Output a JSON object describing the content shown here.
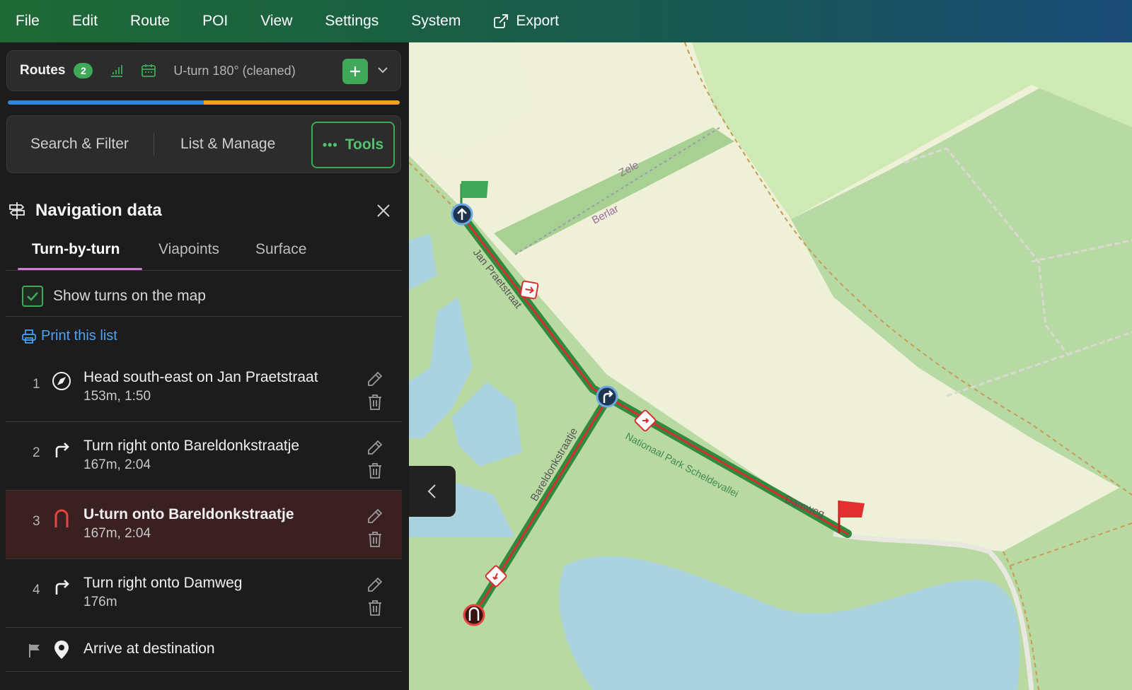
{
  "menu": {
    "items": [
      "File",
      "Edit",
      "Route",
      "POI",
      "View",
      "Settings",
      "System"
    ],
    "export_label": "Export"
  },
  "routes": {
    "label": "Routes",
    "count": "2",
    "current_route": "U-turn 180° (cleaned)"
  },
  "tool_tabs": {
    "search": "Search & Filter",
    "list": "List & Manage",
    "tools": "Tools"
  },
  "panel": {
    "title": "Navigation data",
    "tabs": [
      "Turn-by-turn",
      "Viapoints",
      "Surface"
    ],
    "show_turns_label": "Show turns on the map",
    "show_turns_checked": true,
    "print_label": "Print this list"
  },
  "turns": [
    {
      "num": "1",
      "icon": "compass-icon",
      "text": "Head south-east on Jan Praetstraat",
      "sub": "153m, 1:50"
    },
    {
      "num": "2",
      "icon": "turn-right-icon",
      "text": "Turn right onto Bareldonkstraatje",
      "sub": "167m, 2:04"
    },
    {
      "num": "3",
      "icon": "u-turn-icon",
      "text": "U-turn onto Bareldonkstraatje",
      "sub": "167m, 2:04",
      "selected": true
    },
    {
      "num": "4",
      "icon": "turn-right-icon",
      "text": "Turn right onto Damweg",
      "sub": "176m"
    }
  ],
  "arrive": {
    "icon": "location-pin-icon",
    "text": "Arrive at destination"
  },
  "map": {
    "labels": {
      "zele": "Zele",
      "berlar": "Berlar",
      "jan": "Jan Praetstraat",
      "bareldonk": "Bareldonkstraatje",
      "park": "Nationaal Park Scheldevallei",
      "damweg": "Damweg"
    }
  },
  "colors": {
    "accent_green": "#3fa859",
    "route_red": "#d62f2f",
    "route_green": "#2f8a3e",
    "link_blue": "#4aa3ff",
    "progress_blue": "#2f87d8",
    "progress_orange": "#f5a11c"
  }
}
